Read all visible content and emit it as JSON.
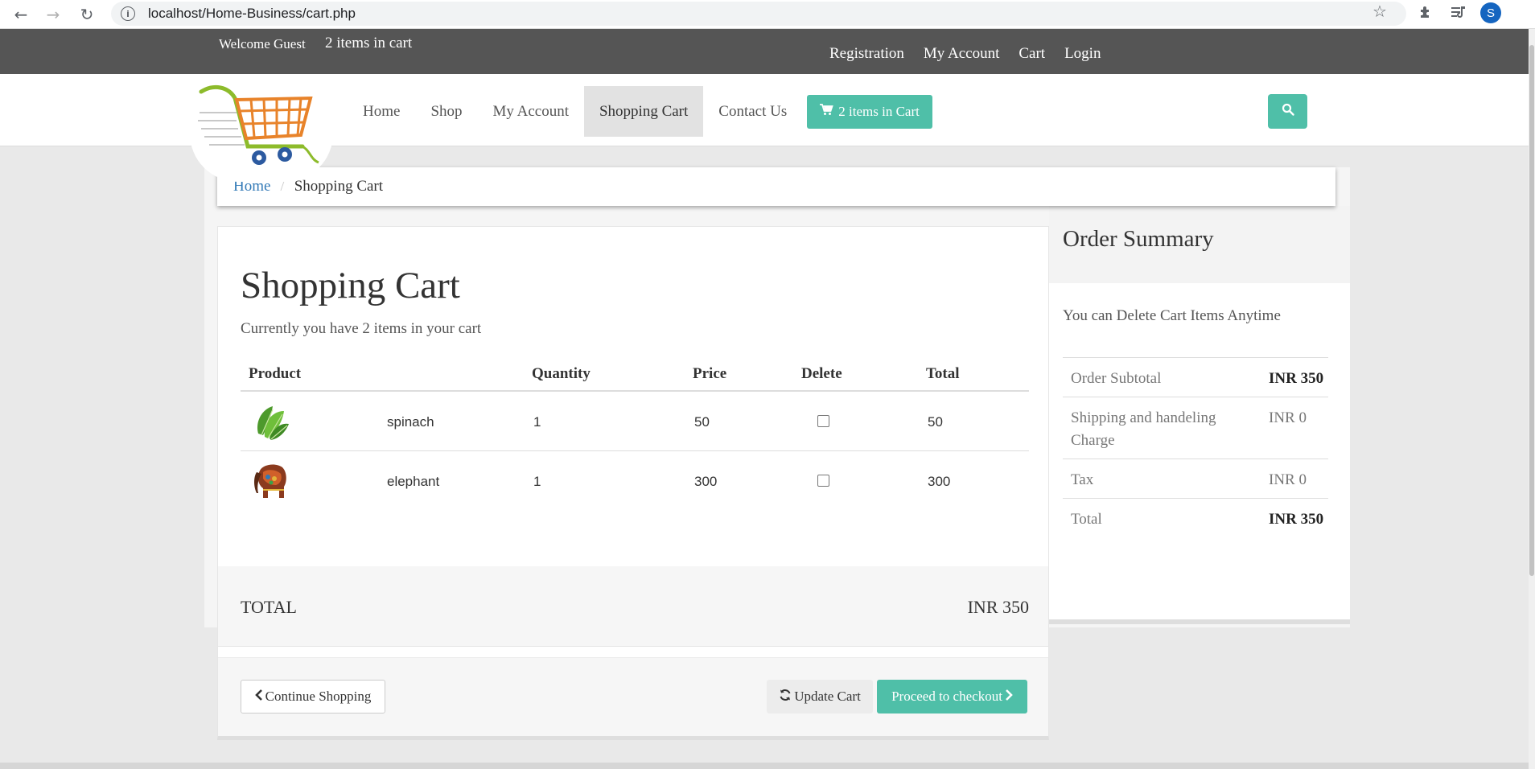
{
  "browser": {
    "url": "localhost/Home-Business/cart.php",
    "back": "←",
    "forward": "→",
    "reload": "↻",
    "info": "i",
    "star": "☆",
    "profile_initial": "S"
  },
  "topbar": {
    "welcome": "Welcome Guest",
    "cart_count": "2 items in cart",
    "links": [
      "Registration",
      "My Account",
      "Cart",
      "Login"
    ]
  },
  "nav": {
    "items": [
      "Home",
      "Shop",
      "My Account",
      "Shopping Cart",
      "Contact Us"
    ],
    "active": "Shopping Cart",
    "cart_button": "2 items in Cart"
  },
  "breadcrumb": {
    "home": "Home",
    "current": "Shopping Cart"
  },
  "cart": {
    "title": "Shopping Cart",
    "subtitle": "Currently you have 2 items in your cart",
    "headers": {
      "product": "Product",
      "quantity": "Quantity",
      "price": "Price",
      "delete": "Delete",
      "total": "Total"
    },
    "rows": [
      {
        "name": "spinach",
        "quantity": "1",
        "price": "50",
        "total": "50",
        "icon": "spinach-image"
      },
      {
        "name": "elephant",
        "quantity": "1",
        "price": "300",
        "total": "300",
        "icon": "elephant-image"
      }
    ],
    "total_label": "TOTAL",
    "total_value": "INR 350",
    "continue_label": "Continue Shopping",
    "update_label": "Update Cart",
    "checkout_label": "Proceed to checkout"
  },
  "summary": {
    "title": "Order Summary",
    "note": "You can Delete Cart Items Anytime",
    "rows": [
      {
        "label": "Order Subtotal",
        "value": "INR 350"
      },
      {
        "label": "Shipping and handeling Charge",
        "value": "INR 0"
      },
      {
        "label": "Tax",
        "value": "INR 0"
      },
      {
        "label": "Total",
        "value": "INR 350"
      }
    ]
  },
  "colors": {
    "accent": "#4fbfa8",
    "topbar": "#555555",
    "link": "#337ab7"
  }
}
